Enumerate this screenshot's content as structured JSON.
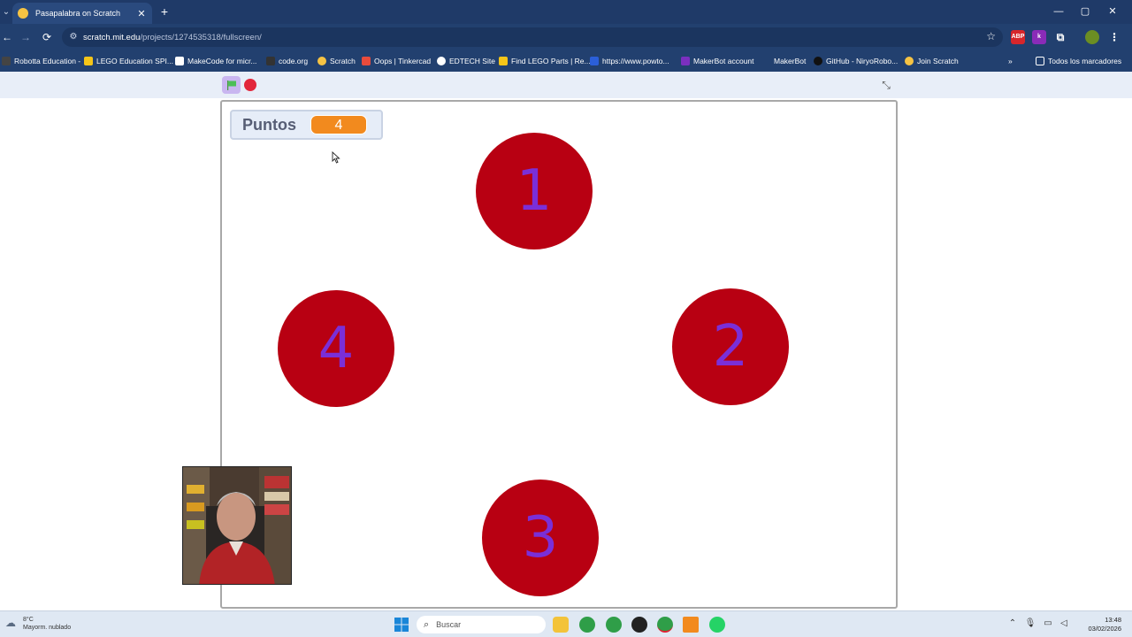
{
  "browser": {
    "tab_title": "Pasapalabra on Scratch",
    "url_host": "scratch.mit.edu",
    "url_path": "/projects/1274535318/fullscreen/",
    "bookmarks": [
      "Robotta Education -",
      "LEGO Education SPI...",
      "MakeCode for micr...",
      "code.org",
      "Scratch",
      "Oops | Tinkercad",
      "EDTECH Site",
      "Find LEGO Parts | Re...",
      "https://www.powto...",
      "MakerBot account",
      "MakerBot",
      "GitHub - NiryoRobo...",
      "Join Scratch"
    ],
    "all_bookmarks": "Todos los marcadores",
    "extensions": [
      "ABP",
      "k"
    ]
  },
  "stage": {
    "monitor_label": "Puntos",
    "monitor_value": "4",
    "circles": [
      "1",
      "2",
      "3",
      "4"
    ]
  },
  "colors": {
    "circle_fill": "#b80012",
    "circle_number": "#7a2fd8",
    "monitor_value_bg": "#f28a1e"
  },
  "taskbar": {
    "weather_temp": "8°C",
    "weather_desc": "Mayorm. nublado",
    "search_placeholder": "Buscar",
    "time": "13:48",
    "date": "03/02/2026"
  }
}
